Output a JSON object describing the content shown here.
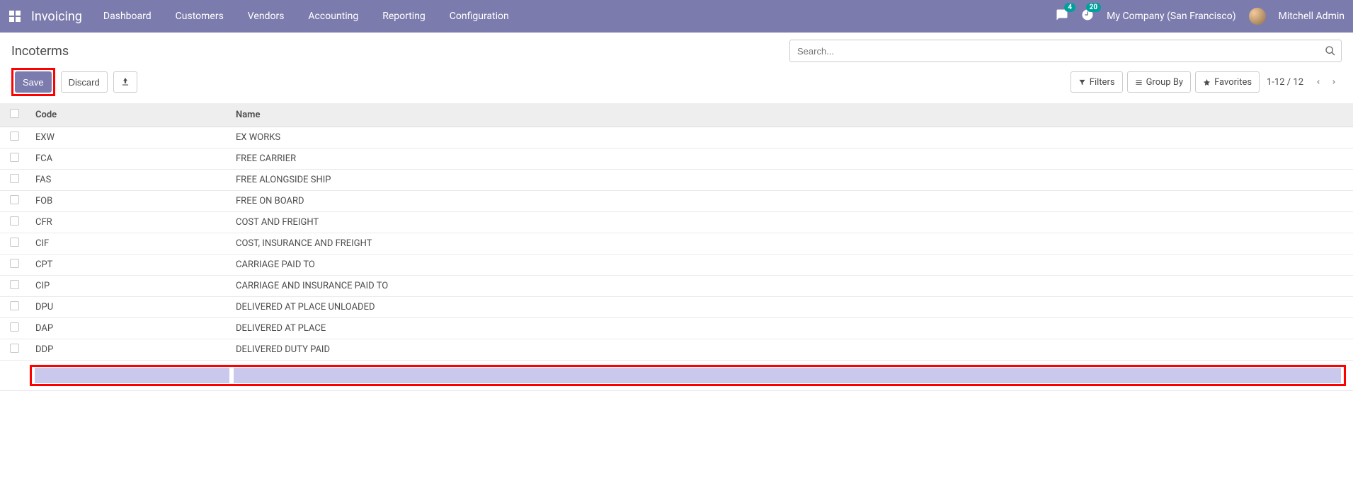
{
  "navbar": {
    "brand": "Invoicing",
    "menu": [
      "Dashboard",
      "Customers",
      "Vendors",
      "Accounting",
      "Reporting",
      "Configuration"
    ],
    "chat_badge": "4",
    "activity_badge": "20",
    "company": "My Company (San Francisco)",
    "user": "Mitchell Admin"
  },
  "page": {
    "title": "Incoterms",
    "save_label": "Save",
    "discard_label": "Discard"
  },
  "search": {
    "placeholder": "Search...",
    "filters_label": "Filters",
    "groupby_label": "Group By",
    "favorites_label": "Favorites"
  },
  "pager": {
    "range": "1-12 / 12"
  },
  "table": {
    "headers": {
      "code": "Code",
      "name": "Name"
    },
    "rows": [
      {
        "code": "EXW",
        "name": "EX WORKS"
      },
      {
        "code": "FCA",
        "name": "FREE CARRIER"
      },
      {
        "code": "FAS",
        "name": "FREE ALONGSIDE SHIP"
      },
      {
        "code": "FOB",
        "name": "FREE ON BOARD"
      },
      {
        "code": "CFR",
        "name": "COST AND FREIGHT"
      },
      {
        "code": "CIF",
        "name": "COST, INSURANCE AND FREIGHT"
      },
      {
        "code": "CPT",
        "name": "CARRIAGE PAID TO"
      },
      {
        "code": "CIP",
        "name": "CARRIAGE AND INSURANCE PAID TO"
      },
      {
        "code": "DPU",
        "name": "DELIVERED AT PLACE UNLOADED"
      },
      {
        "code": "DAP",
        "name": "DELIVERED AT PLACE"
      },
      {
        "code": "DDP",
        "name": "DELIVERED DUTY PAID"
      }
    ],
    "new_row": {
      "code": "",
      "name": ""
    }
  },
  "colors": {
    "primary": "#7c7bad",
    "highlight": "#ff0000",
    "edit_bg": "#cac8ec"
  }
}
